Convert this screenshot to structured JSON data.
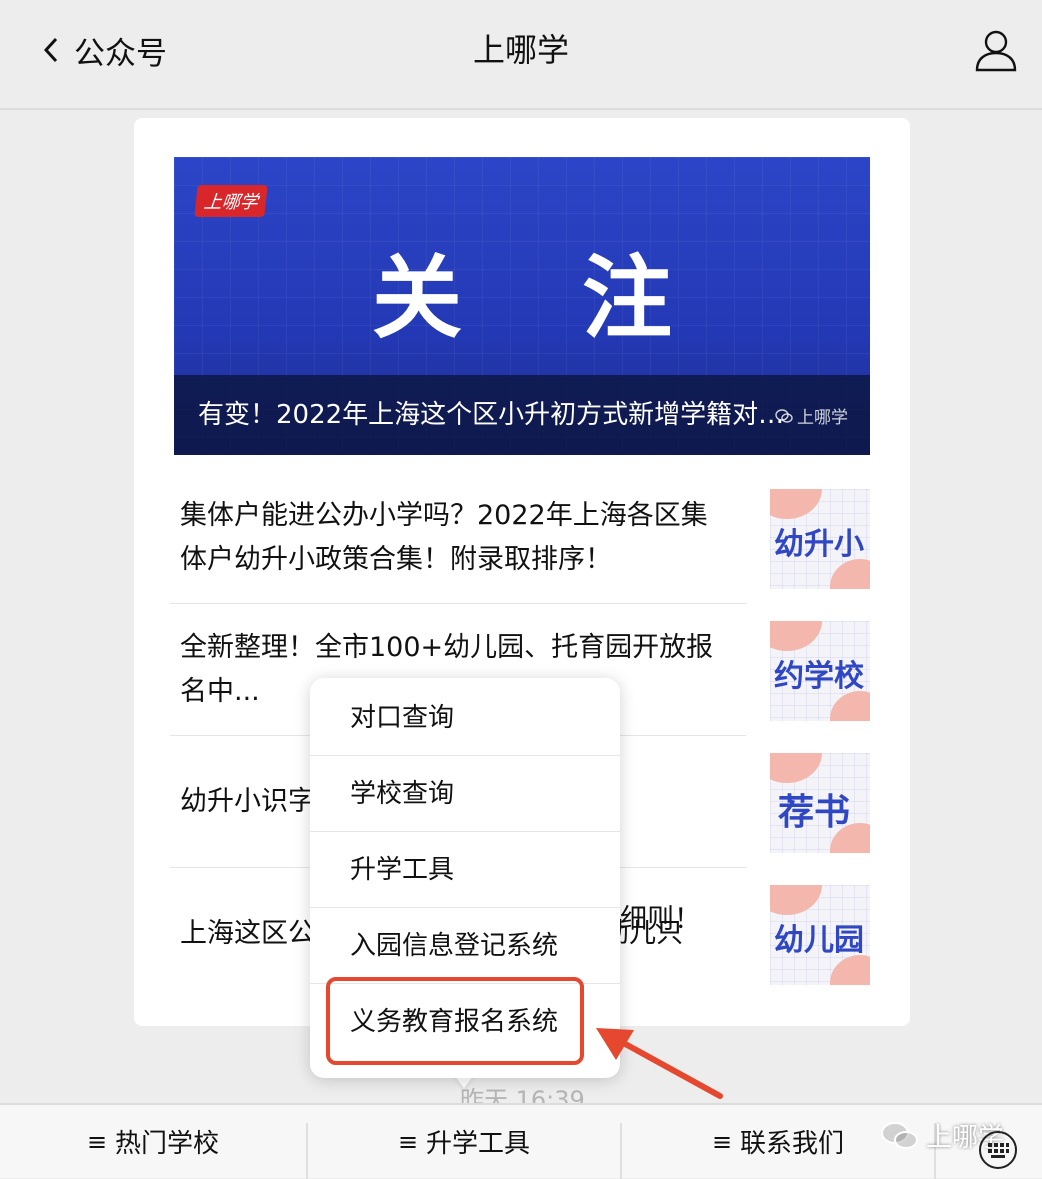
{
  "header": {
    "back_label": "公众号",
    "title": "上哪学"
  },
  "banner": {
    "badge": "上哪学",
    "big_text": "关注",
    "caption": "有变！2022年上海这个区小升初方式新增学籍对口...",
    "watermark": "上哪学"
  },
  "articles": [
    {
      "title": "集体户能进公办小学吗？2022年上海各区集体户幼升小政策合集！附录取排序！",
      "thumb": "幼升小"
    },
    {
      "title": "全新整理！全市100+幼儿园、托育园开放报名中...",
      "thumb": "约学校"
    },
    {
      "title": "幼升小识字",
      "thumb": "荐书"
    },
    {
      "title": "上海这区公办幼儿园招生细则！1名幼儿只",
      "title_tail": "细则！",
      "thumb": "幼儿园"
    }
  ],
  "popup_menu": {
    "items": [
      "对口查询",
      "学校查询",
      "升学工具",
      "入园信息登记系统",
      "义务教育报名系统"
    ],
    "highlighted": "义务教育报名系统"
  },
  "timestamp": "昨天 16:39",
  "bottom_bar": {
    "tabs": [
      "热门学校",
      "升学工具",
      "联系我们"
    ],
    "watermark": "上哪学"
  },
  "colors": {
    "highlight": "#e5482f",
    "banner": "#2338b4",
    "thumb_text": "#2f47c2"
  }
}
